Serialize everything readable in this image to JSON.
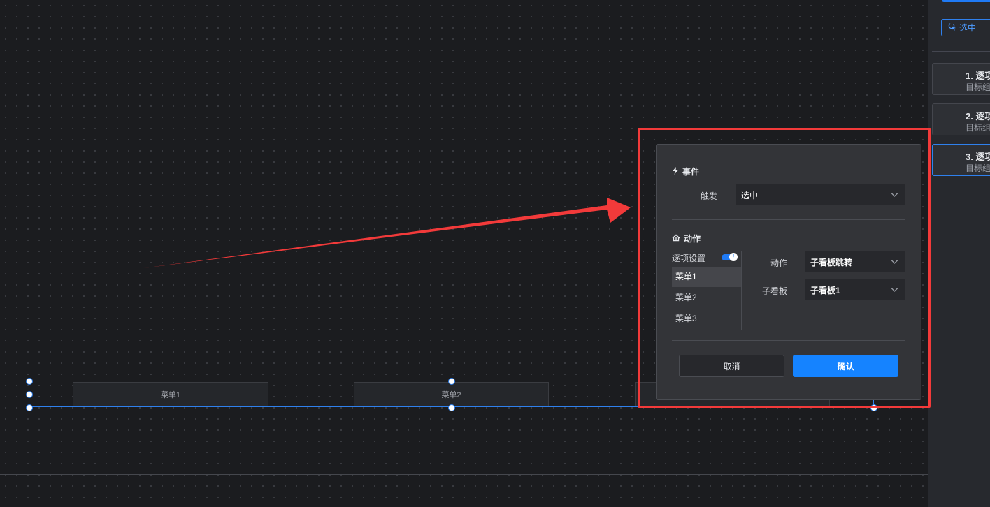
{
  "canvas": {
    "menu_component": {
      "items": [
        "菜单1",
        "菜单2"
      ]
    }
  },
  "side_panel": {
    "select_button_label": "选中",
    "cards": [
      {
        "title": "1. 逐项",
        "subtitle": "目标组"
      },
      {
        "title": "2. 逐项",
        "subtitle": "目标组"
      },
      {
        "title": "3. 逐项",
        "subtitle": "目标组",
        "active": true
      }
    ]
  },
  "dialog": {
    "event_section_title": "事件",
    "trigger_label": "触发",
    "trigger_value": "选中",
    "action_section_title": "动作",
    "item_setting_label": "逐项设置",
    "item_setting_enabled": true,
    "menu_items": [
      "菜单1",
      "菜单2",
      "菜单3"
    ],
    "selected_menu_item": "菜单1",
    "action_label": "动作",
    "action_value": "子看板跳转",
    "sub_board_label": "子看板",
    "sub_board_value": "子看板1",
    "cancel_label": "取消",
    "confirm_label": "确认"
  },
  "colors": {
    "accent": "#1583ff",
    "annotation": "#f23a3a",
    "dialog_bg": "#333438",
    "canvas_bg": "#1b1c1f"
  },
  "icons": {
    "event": "lightning-icon",
    "action": "action-icon",
    "select": "pointer-click-icon",
    "dropdown": "chevron-down-icon"
  }
}
